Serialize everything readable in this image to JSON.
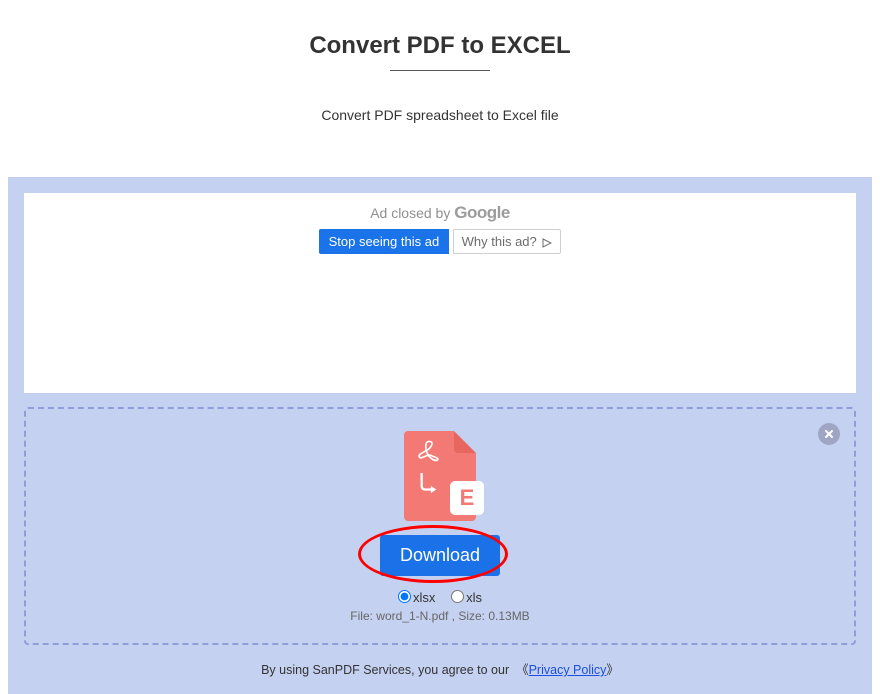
{
  "header": {
    "title": "Convert PDF to EXCEL",
    "subtitle": "Convert PDF spreadsheet to Excel file"
  },
  "ad": {
    "closed_prefix": "Ad closed by",
    "provider": "Google",
    "stop_label": "Stop seeing this ad",
    "why_label": "Why this ad?"
  },
  "dropzone": {
    "download_label": "Download",
    "format_options": [
      {
        "value": "xlsx",
        "label": "xlsx",
        "checked": true
      },
      {
        "value": "xls",
        "label": "xls",
        "checked": false
      }
    ],
    "file_info": "File: word_1-N.pdf , Size: 0.13MB",
    "excel_letter": "E"
  },
  "footer": {
    "text_before": "By using SanPDF Services, you agree to our",
    "policy_label": "Privacy Policy",
    "bracket_open": "《",
    "bracket_close": "》"
  },
  "colors": {
    "panel_bg": "#c5d1f0",
    "accent_blue": "#1b72e8",
    "file_red": "#f37974",
    "annotation_red": "#ff0000"
  }
}
